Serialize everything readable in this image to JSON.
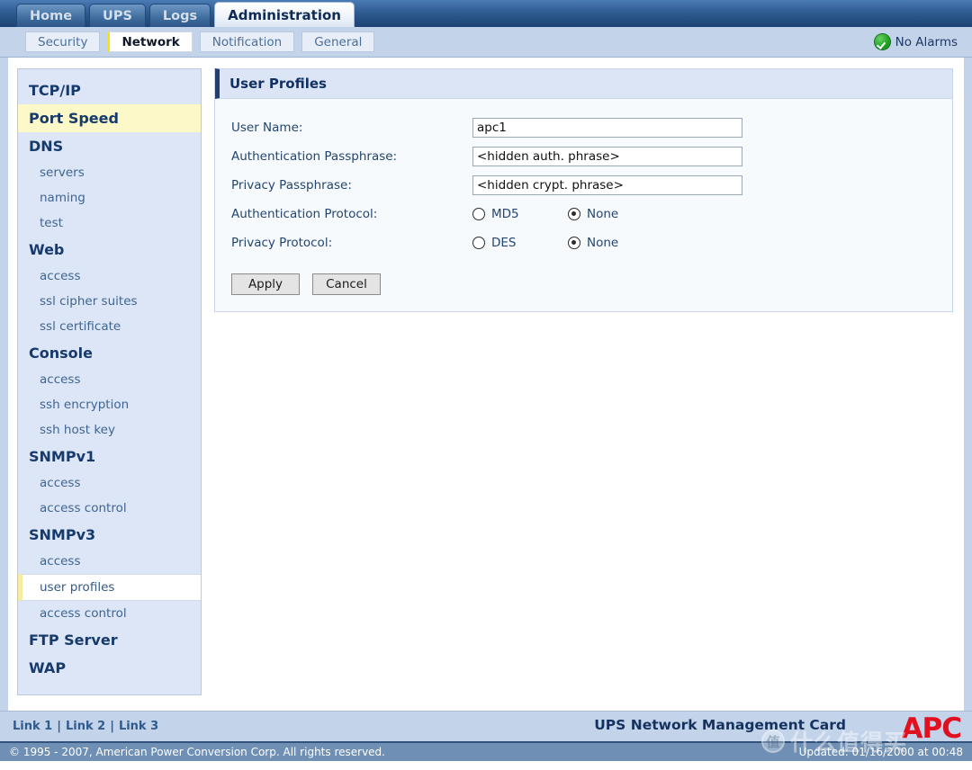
{
  "main_tabs": [
    {
      "label": "Home",
      "active": false
    },
    {
      "label": "UPS",
      "active": false
    },
    {
      "label": "Logs",
      "active": false
    },
    {
      "label": "Administration",
      "active": true
    }
  ],
  "sub_tabs": [
    {
      "label": "Security",
      "active": false
    },
    {
      "label": "Network",
      "active": true
    },
    {
      "label": "Notification",
      "active": false
    },
    {
      "label": "General",
      "active": false
    }
  ],
  "alarm": {
    "label": "No Alarms",
    "icon": "green-check-icon",
    "color": "#22a522"
  },
  "sidebar": [
    {
      "label": "TCP/IP",
      "type": "head",
      "selected": false
    },
    {
      "label": "Port Speed",
      "type": "head",
      "selected": true
    },
    {
      "label": "DNS",
      "type": "head",
      "selected": false
    },
    {
      "label": "servers",
      "type": "sub",
      "selected": false
    },
    {
      "label": "naming",
      "type": "sub",
      "selected": false
    },
    {
      "label": "test",
      "type": "sub",
      "selected": false
    },
    {
      "label": "Web",
      "type": "head",
      "selected": false
    },
    {
      "label": "access",
      "type": "sub",
      "selected": false
    },
    {
      "label": "ssl cipher suites",
      "type": "sub",
      "selected": false
    },
    {
      "label": "ssl certificate",
      "type": "sub",
      "selected": false
    },
    {
      "label": "Console",
      "type": "head",
      "selected": false
    },
    {
      "label": "access",
      "type": "sub",
      "selected": false
    },
    {
      "label": "ssh encryption",
      "type": "sub",
      "selected": false
    },
    {
      "label": "ssh host key",
      "type": "sub",
      "selected": false
    },
    {
      "label": "SNMPv1",
      "type": "head",
      "selected": false
    },
    {
      "label": "access",
      "type": "sub",
      "selected": false
    },
    {
      "label": "access control",
      "type": "sub",
      "selected": false
    },
    {
      "label": "SNMPv3",
      "type": "head",
      "selected": false
    },
    {
      "label": "access",
      "type": "sub",
      "selected": false
    },
    {
      "label": "user profiles",
      "type": "sub",
      "selected": true
    },
    {
      "label": "access control",
      "type": "sub",
      "selected": false
    },
    {
      "label": "FTP Server",
      "type": "head",
      "selected": false
    },
    {
      "label": "WAP",
      "type": "head",
      "selected": false
    }
  ],
  "panel": {
    "title": "User Profiles",
    "fields": {
      "user_name": {
        "label": "User Name:",
        "value": "apc1"
      },
      "auth_passphrase": {
        "label": "Authentication Passphrase:",
        "value": "<hidden auth. phrase>"
      },
      "privacy_passphrase": {
        "label": "Privacy Passphrase:",
        "value": "<hidden crypt. phrase>"
      },
      "auth_protocol": {
        "label": "Authentication Protocol:",
        "options": [
          {
            "label": "MD5",
            "checked": false
          },
          {
            "label": "None",
            "checked": true
          }
        ]
      },
      "privacy_protocol": {
        "label": "Privacy Protocol:",
        "options": [
          {
            "label": "DES",
            "checked": false
          },
          {
            "label": "None",
            "checked": true
          }
        ]
      }
    },
    "buttons": {
      "apply": "Apply",
      "cancel": "Cancel"
    }
  },
  "footer": {
    "links": [
      "Link 1",
      "Link 2",
      "Link 3"
    ],
    "separator": "|",
    "product": "UPS Network Management Card",
    "logo": "APC",
    "copyright": "© 1995 - 2007, American Power Conversion Corp. All rights reserved.",
    "updated": "Updated: 01/16/2000 at 00:48"
  },
  "watermark": {
    "mark": "值",
    "text": "什么值得买"
  }
}
